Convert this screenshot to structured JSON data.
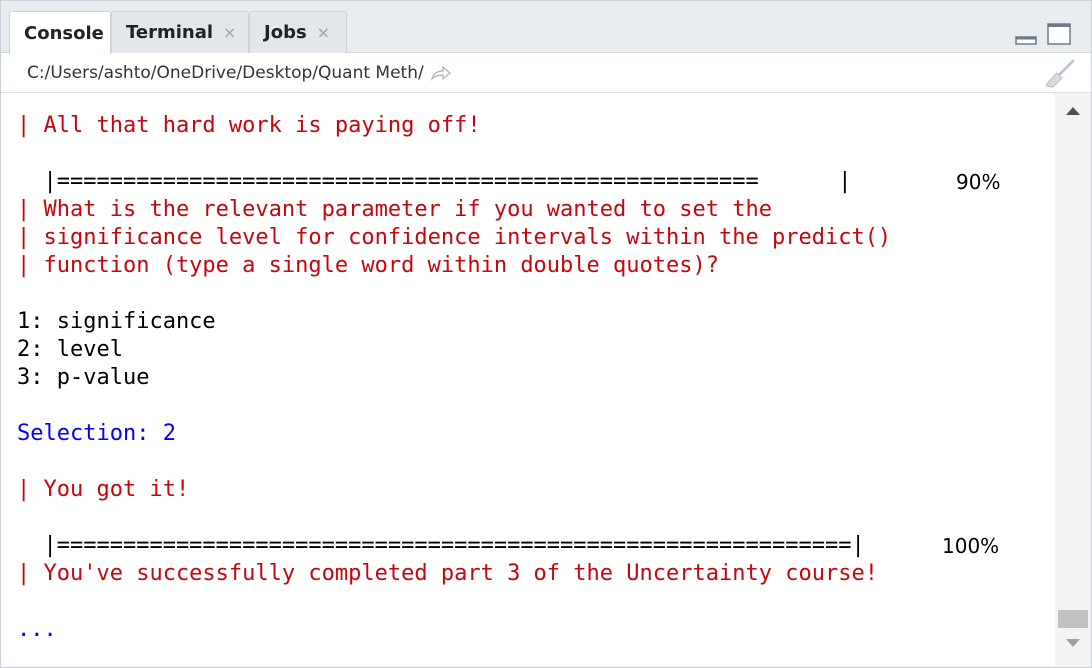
{
  "tabs": [
    {
      "label": "Console",
      "active": true,
      "closable": false
    },
    {
      "label": "Terminal",
      "active": false,
      "closable": true
    },
    {
      "label": "Jobs",
      "active": false,
      "closable": true
    }
  ],
  "tab_close_glyph": "×",
  "path": {
    "text": "C:/Users/ashto/OneDrive/Desktop/Quant Meth/"
  },
  "icons": {
    "minimize": "minimize-pane-icon",
    "maximize": "maximize-pane-icon",
    "goto_dir": "go-to-directory-arrow-icon",
    "clear": "clear-console-broom-icon",
    "scroll_up": "scroll-up-arrow-icon",
    "scroll_down": "scroll-down-arrow-icon"
  },
  "colors": {
    "message_red": "#c5060b",
    "prompt_blue": "#0000ff",
    "output_black": "#000000",
    "tab_bar_bg": "#e9ecef"
  },
  "console": {
    "line1": "| All that hard work is paying off!",
    "progress1_bar": "  |=====================================================      |",
    "progress1_pct": "90%",
    "q1": "| What is the relevant parameter if you wanted to set the",
    "q2": "| significance level for confidence intervals within the predict()",
    "q3": "| function (type a single word within double quotes)?",
    "opt1": "1: significance",
    "opt2": "2: level",
    "opt3": "3: p-value",
    "selection": "Selection: 2",
    "got_it": "| You got it!",
    "progress2_bar": "  |============================================================|",
    "progress2_pct": "100%",
    "done": "| You've successfully completed part 3 of the Uncertainty course!",
    "prompt": "..."
  },
  "progress": {
    "first_percent": 90,
    "second_percent": 100
  }
}
